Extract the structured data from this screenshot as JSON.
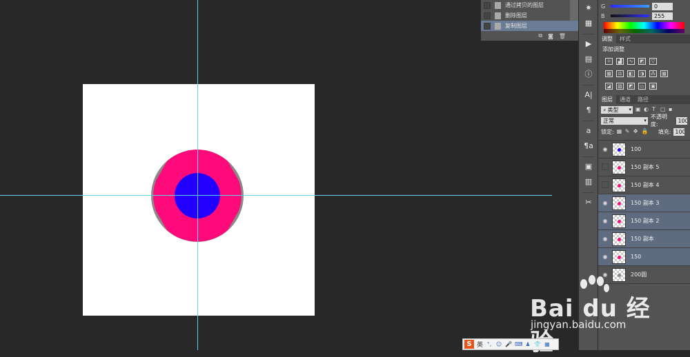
{
  "history": {
    "rows": [
      "通过拷贝的图层",
      "删除图层",
      "复制图层"
    ],
    "selected_index": 2
  },
  "color_panel": {
    "g_label": "G",
    "g_value": "0",
    "b_label": "B",
    "b_value": "255"
  },
  "adjust_panel": {
    "tabs": [
      "调整",
      "样式"
    ],
    "active_tab": "调整",
    "title": "添加调整"
  },
  "layers_panel": {
    "tabs": [
      "图层",
      "通道",
      "路径"
    ],
    "active_tab": "图层",
    "filter_kind": "类型",
    "blend_mode": "正常",
    "opacity_label": "不透明度:",
    "opacity_value": "100",
    "lock_label": "锁定:",
    "fill_label": "填充:",
    "fill_value": "100",
    "layers": [
      {
        "name": "100",
        "visible": true,
        "selected": false,
        "dot_color": "#2200ff"
      },
      {
        "name": "150 副本 5",
        "visible": false,
        "selected": false,
        "dot_color": "#ff0a7a"
      },
      {
        "name": "150 副本 4",
        "visible": false,
        "selected": false,
        "dot_color": "#ff0a7a"
      },
      {
        "name": "150 副本 3",
        "visible": true,
        "selected": true,
        "dot_color": "#ff0a7a"
      },
      {
        "name": "150 副本 2",
        "visible": true,
        "selected": true,
        "dot_color": "#ff0a7a"
      },
      {
        "name": "150 副本",
        "visible": true,
        "selected": true,
        "dot_color": "#ff0a7a"
      },
      {
        "name": "150",
        "visible": true,
        "selected": true,
        "dot_color": "#ff0a7a"
      },
      {
        "name": "200圆",
        "visible": true,
        "selected": false,
        "dot_color": "#8a8a8a"
      }
    ]
  },
  "canvas": {
    "outer_color": "#8a8a8a",
    "ring_color": "#ff0a7a",
    "inner_color": "#2200ff",
    "guide_color": "#5fd3e8"
  },
  "watermark": {
    "brand": "Bai du 经验",
    "url": "jingyan.baidu.com"
  },
  "ime": {
    "mode": "英"
  }
}
